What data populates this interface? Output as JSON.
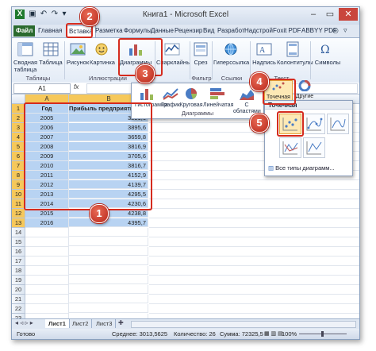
{
  "window": {
    "title": "Книга1 - Microsoft Excel",
    "controls": {
      "minimize": "–",
      "restore": "▭",
      "close": "✕"
    }
  },
  "tabs": [
    "Файл",
    "Главная",
    "Вставка",
    "Разметка",
    "Формулы",
    "Данные",
    "Рецензир",
    "Вид",
    "Разработ",
    "Надстрой",
    "Foxit PDF",
    "ABBYY PDF"
  ],
  "ribbon": {
    "buttons": [
      {
        "label": "Сводная таблица",
        "icon": "pivot-table-icon"
      },
      {
        "label": "Таблица",
        "icon": "table-icon"
      },
      {
        "label": "Рисунок",
        "icon": "picture-icon"
      },
      {
        "label": "Картинка",
        "icon": "clipart-icon"
      },
      {
        "label": "Диаграммы",
        "icon": "charts-icon"
      },
      {
        "label": "Спарклайны",
        "icon": "sparklines-icon"
      },
      {
        "label": "Срез",
        "icon": "slicer-icon"
      },
      {
        "label": "Гиперссылка",
        "icon": "hyperlink-icon"
      },
      {
        "label": "Надпись",
        "icon": "textbox-icon"
      },
      {
        "label": "Колонтитулы",
        "icon": "header-footer-icon"
      },
      {
        "label": "Символы",
        "icon": "symbols-icon"
      }
    ],
    "groups": [
      "Таблицы",
      "Иллюстрации",
      "Фильтр",
      "Ссылки",
      "Текст"
    ]
  },
  "formula_bar": {
    "name_box": "A1",
    "fx": "fx"
  },
  "columns": [
    "A",
    "B"
  ],
  "rows": [
    {
      "n": "1",
      "a": "Год",
      "b": "Прибыль предприятия, т"
    },
    {
      "n": "2",
      "a": "2005",
      "b": "3291,6"
    },
    {
      "n": "3",
      "a": "2006",
      "b": "3895,6"
    },
    {
      "n": "4",
      "a": "2007",
      "b": "3659,8"
    },
    {
      "n": "5",
      "a": "2008",
      "b": "3816,9"
    },
    {
      "n": "6",
      "a": "2009",
      "b": "3705,6"
    },
    {
      "n": "7",
      "a": "2010",
      "b": "3816,7"
    },
    {
      "n": "8",
      "a": "2011",
      "b": "4152,9"
    },
    {
      "n": "9",
      "a": "2012",
      "b": "4139,7"
    },
    {
      "n": "10",
      "a": "2013",
      "b": "4295,5"
    },
    {
      "n": "11",
      "a": "2014",
      "b": "4230,6"
    },
    {
      "n": "12",
      "a": "2015",
      "b": "4238,8"
    },
    {
      "n": "13",
      "a": "2016",
      "b": "4395,7"
    },
    {
      "n": "14",
      "a": "",
      "b": ""
    },
    {
      "n": "15",
      "a": "",
      "b": ""
    },
    {
      "n": "16",
      "a": "",
      "b": ""
    },
    {
      "n": "17",
      "a": "",
      "b": ""
    },
    {
      "n": "18",
      "a": "",
      "b": ""
    },
    {
      "n": "19",
      "a": "",
      "b": ""
    },
    {
      "n": "20",
      "a": "",
      "b": ""
    },
    {
      "n": "21",
      "a": "",
      "b": ""
    },
    {
      "n": "22",
      "a": "",
      "b": ""
    },
    {
      "n": "23",
      "a": "",
      "b": ""
    }
  ],
  "charts_menu": {
    "items": [
      "Гистограмма",
      "График",
      "Круговая",
      "Линейчатая",
      "С областями",
      "Точечная",
      "Другие"
    ],
    "group": "Диаграммы"
  },
  "scatter_menu": {
    "title": "Точечная",
    "all_charts": "Все типы диаграмм..."
  },
  "sheets": [
    "Лист1",
    "Лист2",
    "Лист3"
  ],
  "status": {
    "ready": "Готово",
    "average": "Среднее: 3013,5625",
    "count": "Количество: 26",
    "sum": "Сумма: 72325,5",
    "zoom": "100%"
  },
  "callouts": [
    "1",
    "2",
    "3",
    "4",
    "5"
  ],
  "colors": {
    "accent": "#d52b1e",
    "file_tab": "#2a6a2e",
    "selection": "#b8d3f2",
    "highlight": "#fde9b5"
  }
}
